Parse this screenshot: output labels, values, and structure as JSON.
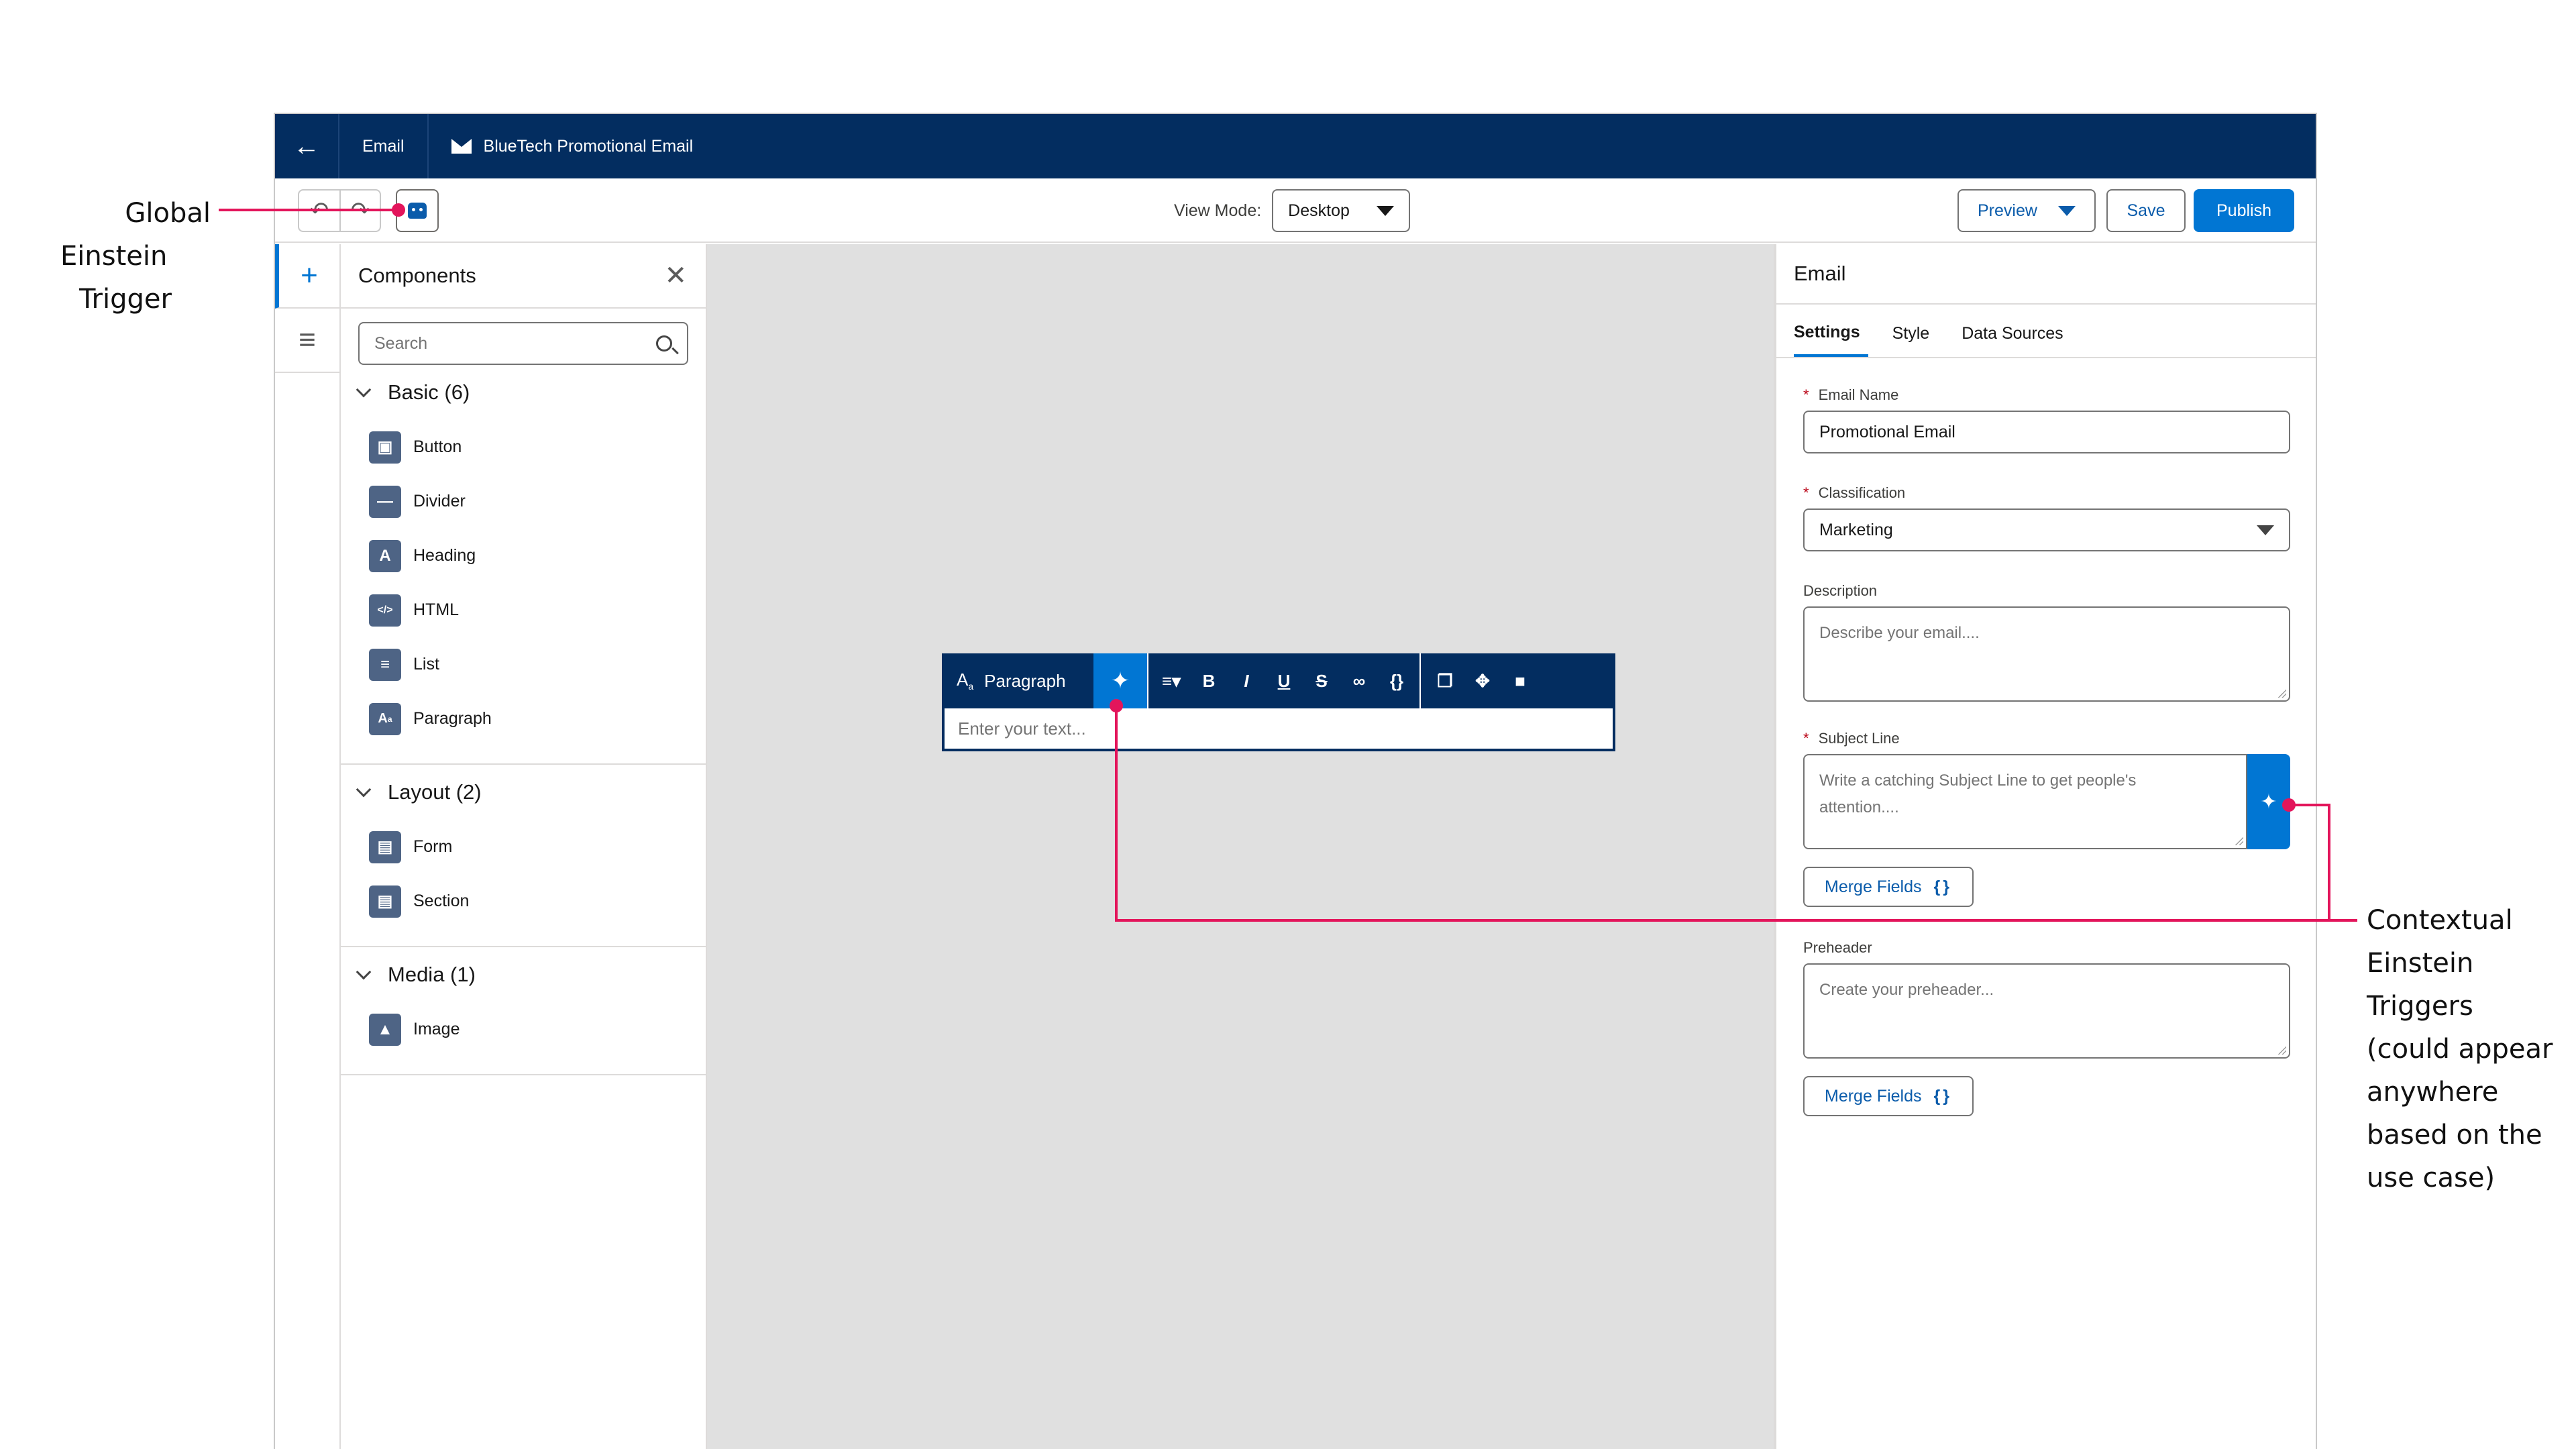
{
  "annotations": {
    "global": [
      "Global",
      "Einstein",
      "Trigger"
    ],
    "contextual": [
      "Contextual",
      "Einstein",
      "Triggers",
      "(could appear",
      "anywhere",
      "based on the",
      "use case)"
    ]
  },
  "topbar": {
    "tab_email": "Email",
    "tab_doc": "BlueTech Promotional Email"
  },
  "toolbar": {
    "view_mode_label": "View Mode:",
    "view_mode_value": "Desktop",
    "preview_label": "Preview",
    "save_label": "Save",
    "publish_label": "Publish"
  },
  "components": {
    "title": "Components",
    "search_placeholder": "Search",
    "sections": [
      {
        "title": "Basic (6)",
        "items": [
          "Button",
          "Divider",
          "Heading",
          "HTML",
          "List",
          "Paragraph"
        ]
      },
      {
        "title": "Layout (2)",
        "items": [
          "Form",
          "Section"
        ]
      },
      {
        "title": "Media (1)",
        "items": [
          "Image"
        ]
      }
    ]
  },
  "editor": {
    "block_type": "Paragraph",
    "placeholder": "Enter your text..."
  },
  "properties": {
    "title": "Email",
    "tabs": [
      "Settings",
      "Style",
      "Data Sources"
    ],
    "email_name_label": "Email Name",
    "email_name_value": "Promotional Email",
    "classification_label": "Classification",
    "classification_value": "Marketing",
    "description_label": "Description",
    "description_placeholder": "Describe your email....",
    "subject_label": "Subject Line",
    "subject_placeholder": "Write a catching Subject Line to get people's attention....",
    "merge_fields_label": "Merge Fields",
    "preheader_label": "Preheader",
    "preheader_placeholder": "Create your preheader..."
  },
  "colors": {
    "accent": "#0176d3",
    "navy": "#032d60",
    "callout": "#e3155b"
  }
}
